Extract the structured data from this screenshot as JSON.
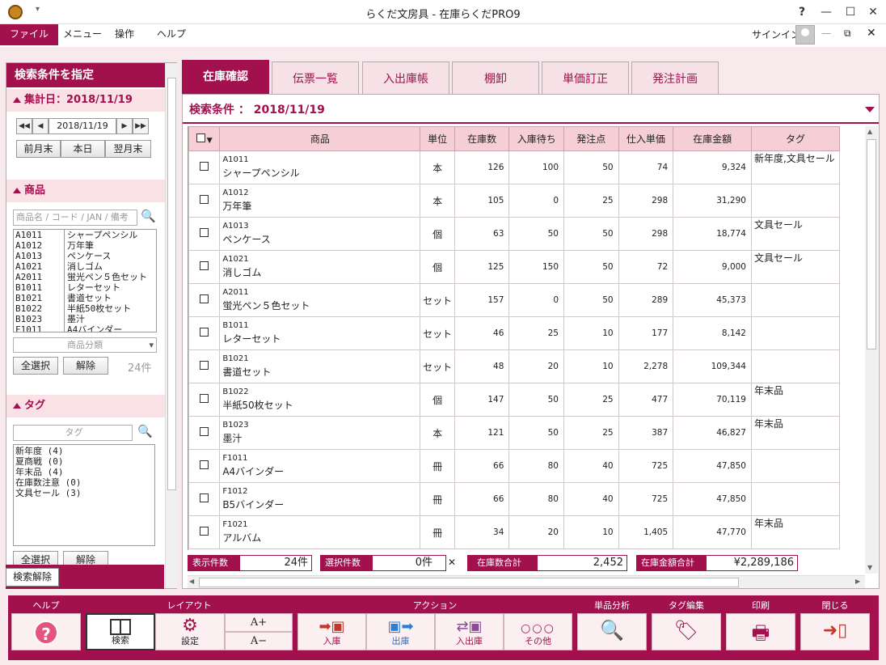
{
  "window": {
    "title": "らくだ文房具 - 在庫らくだPRO9",
    "help": "?",
    "minimize": "—",
    "maximize": "☐",
    "close": "✕"
  },
  "menu": {
    "items": [
      "ファイル",
      "メニュー",
      "操作",
      "ヘルプ"
    ],
    "signin": "サインイン"
  },
  "left": {
    "header": "検索条件を指定",
    "date_section": "集計日：2018/11/19",
    "date_value": "2018/11/19",
    "date_buttons": [
      "前月末",
      "本日",
      "翌月末"
    ],
    "product_section": "商品",
    "product_placeholder": "商品名 / コード / JAN / 備考",
    "products": [
      [
        "A1011",
        "シャープペンシル"
      ],
      [
        "A1012",
        "万年筆"
      ],
      [
        "A1013",
        "ペンケース"
      ],
      [
        "A1021",
        "消しゴム"
      ],
      [
        "A2011",
        "蛍光ペン５色セット"
      ],
      [
        "B1011",
        "レターセット"
      ],
      [
        "B1021",
        "書道セット"
      ],
      [
        "B1022",
        "半紙50枚セット"
      ],
      [
        "B1023",
        "墨汁"
      ],
      [
        "F1011",
        "A4バインダー"
      ]
    ],
    "category_placeholder": "商品分類",
    "select_all": "全選択",
    "clear": "解除",
    "product_count": "24件",
    "tag_section": "タグ",
    "tag_placeholder": "タグ",
    "tags": [
      "新年度 (4)",
      "夏商戦 (0)",
      "年末品 (4)",
      "在庫数注意 (0)",
      "文具セール (3)"
    ],
    "tag_select_all": "全選択",
    "tag_clear": "解除",
    "reset": "検索解除"
  },
  "tabs": [
    "在庫確認",
    "伝票一覧",
    "入出庫帳",
    "棚卸",
    "単価訂正",
    "発注計画"
  ],
  "main": {
    "condition": "検索条件 ： 2018/11/19",
    "columns": [
      "商品",
      "単位",
      "在庫数",
      "入庫待ち",
      "発注点",
      "仕入単価",
      "在庫金額",
      "タグ"
    ],
    "rows": [
      {
        "code": "A1011",
        "name": "シャープペンシル",
        "unit": "本",
        "stock": "126",
        "incoming": "100",
        "reorder": "50",
        "price": "74",
        "amount": "9,324",
        "tag": "新年度,文具セール"
      },
      {
        "code": "A1012",
        "name": "万年筆",
        "unit": "本",
        "stock": "105",
        "incoming": "0",
        "reorder": "25",
        "price": "298",
        "amount": "31,290",
        "tag": ""
      },
      {
        "code": "A1013",
        "name": "ペンケース",
        "unit": "個",
        "stock": "63",
        "incoming": "50",
        "reorder": "50",
        "price": "298",
        "amount": "18,774",
        "tag": "文具セール"
      },
      {
        "code": "A1021",
        "name": "消しゴム",
        "unit": "個",
        "stock": "125",
        "incoming": "150",
        "reorder": "50",
        "price": "72",
        "amount": "9,000",
        "tag": "文具セール"
      },
      {
        "code": "A2011",
        "name": "蛍光ペン５色セット",
        "unit": "セット",
        "stock": "157",
        "incoming": "0",
        "reorder": "50",
        "price": "289",
        "amount": "45,373",
        "tag": ""
      },
      {
        "code": "B1011",
        "name": "レターセット",
        "unit": "セット",
        "stock": "46",
        "incoming": "25",
        "reorder": "10",
        "price": "177",
        "amount": "8,142",
        "tag": ""
      },
      {
        "code": "B1021",
        "name": "書道セット",
        "unit": "セット",
        "stock": "48",
        "incoming": "20",
        "reorder": "10",
        "price": "2,278",
        "amount": "109,344",
        "tag": ""
      },
      {
        "code": "B1022",
        "name": "半紙50枚セット",
        "unit": "個",
        "stock": "147",
        "incoming": "50",
        "reorder": "25",
        "price": "477",
        "amount": "70,119",
        "tag": "年末品"
      },
      {
        "code": "B1023",
        "name": "墨汁",
        "unit": "本",
        "stock": "121",
        "incoming": "50",
        "reorder": "25",
        "price": "387",
        "amount": "46,827",
        "tag": "年末品"
      },
      {
        "code": "F1011",
        "name": "A4バインダー",
        "unit": "冊",
        "stock": "66",
        "incoming": "80",
        "reorder": "40",
        "price": "725",
        "amount": "47,850",
        "tag": ""
      },
      {
        "code": "F1012",
        "name": "B5バインダー",
        "unit": "冊",
        "stock": "66",
        "incoming": "80",
        "reorder": "40",
        "price": "725",
        "amount": "47,850",
        "tag": ""
      },
      {
        "code": "F1021",
        "name": "アルバム",
        "unit": "冊",
        "stock": "34",
        "incoming": "20",
        "reorder": "10",
        "price": "1,405",
        "amount": "47,770",
        "tag": "年末品"
      }
    ],
    "summary": {
      "shown_label": "表示件数",
      "shown": "24件",
      "selected_label": "選択件数",
      "selected": "0件",
      "stock_label": "在庫数合計",
      "stock": "2,452",
      "amount_label": "在庫金額合計",
      "amount": "¥2,289,186"
    }
  },
  "toolbar": {
    "groups": [
      "ヘルプ",
      "レイアウト",
      "アクション",
      "単品分析",
      "タグ編集",
      "印刷",
      "閉じる"
    ],
    "search": "検索",
    "settings": "設定",
    "font_up": "A+",
    "font_down": "A−",
    "in": "入庫",
    "out": "出庫",
    "inout": "入出庫",
    "other": "その他"
  },
  "colors": {
    "accent": "#a2104e",
    "pink_bg": "#f7e9ec",
    "header_pink": "#f6cfd6"
  }
}
